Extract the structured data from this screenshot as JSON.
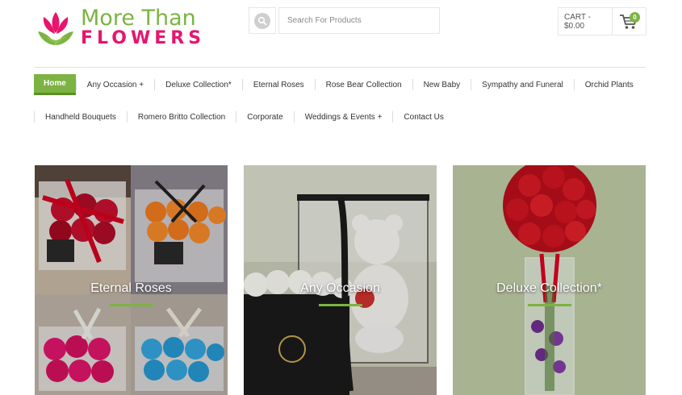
{
  "brand": {
    "line1": "More Than",
    "line2": "FLOWERS",
    "green": "#7cb342",
    "pink": "#e5166e"
  },
  "search": {
    "placeholder": "Search For Products",
    "icon": "search-icon"
  },
  "cart": {
    "label": "CART - $0.00",
    "count": "0",
    "icon": "cart-icon"
  },
  "nav": {
    "row1": [
      {
        "label": "Home"
      },
      {
        "label": "Any Occasion +"
      },
      {
        "label": "Deluxe Collection*"
      },
      {
        "label": "Eternal Roses"
      },
      {
        "label": "Rose Bear Collection"
      },
      {
        "label": "New Baby"
      },
      {
        "label": "Sympathy and Funeral"
      },
      {
        "label": "Orchid Plants"
      }
    ],
    "row2": [
      {
        "label": "Handheld Bouquets"
      },
      {
        "label": "Romero Britto Collection"
      },
      {
        "label": "Corporate"
      },
      {
        "label": "Weddings & Events +"
      },
      {
        "label": "Contact Us"
      }
    ]
  },
  "tiles": [
    {
      "title": "Eternal Roses"
    },
    {
      "title": "Any Occasion"
    },
    {
      "title": "Deluxe Collection*"
    }
  ]
}
